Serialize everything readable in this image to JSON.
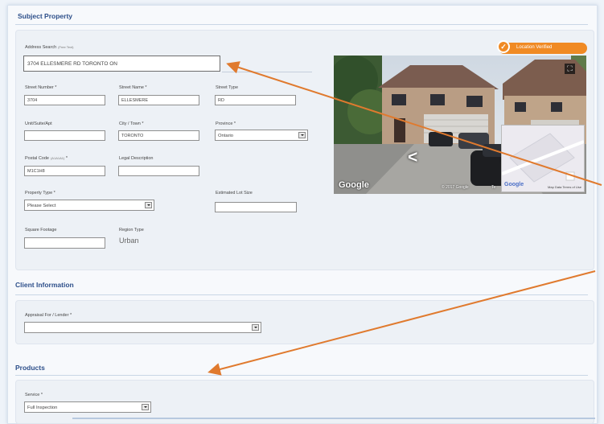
{
  "subject_property": {
    "title": "Subject Property",
    "address_search": {
      "label": "Address Search",
      "hint": "(Free Text)",
      "value": "3704 ELLESMERE RD TORONTO ON"
    },
    "verified_badge": "Location Verified",
    "street_number": {
      "label": "Street Number *",
      "value": "3704"
    },
    "street_name": {
      "label": "Street Name *",
      "value": "ELLESMERE"
    },
    "street_type": {
      "label": "Street Type",
      "value": "RD"
    },
    "unit": {
      "label": "Unit/Suite/Apt",
      "value": ""
    },
    "city": {
      "label": "City / Town *",
      "value": "TORONTO"
    },
    "province": {
      "label": "Province *",
      "value": "Ontario"
    },
    "postal_code": {
      "label": "Postal Code",
      "hint": "(A1A1A1)",
      "label_suffix": "*",
      "value": "M1C1H8"
    },
    "legal_description": {
      "label": "Legal Description",
      "value": ""
    },
    "property_type": {
      "label": "Property Type *",
      "value": "Please Select"
    },
    "lot_size": {
      "label": "Estimated Lot Size",
      "value": ""
    },
    "square_footage": {
      "label": "Square Footage",
      "value": ""
    },
    "region_type": {
      "label": "Region Type",
      "value": "Urban"
    },
    "street_view": {
      "google": "Google",
      "copyright": "© 2017 Google",
      "terms_short": "Te",
      "minimap_google": "Google",
      "minimap_links": "Map Data  Terms of Use"
    }
  },
  "client_information": {
    "title": "Client Information",
    "appraisal_for": {
      "label": "Appraisal For / Lender *",
      "value": ""
    }
  },
  "products": {
    "title": "Products",
    "service": {
      "label": "Service *",
      "value": "Full Inspection"
    }
  },
  "colors": {
    "accent": "#f08a24",
    "section_title": "#2d4f8a",
    "arrow": "#e07a2e"
  }
}
